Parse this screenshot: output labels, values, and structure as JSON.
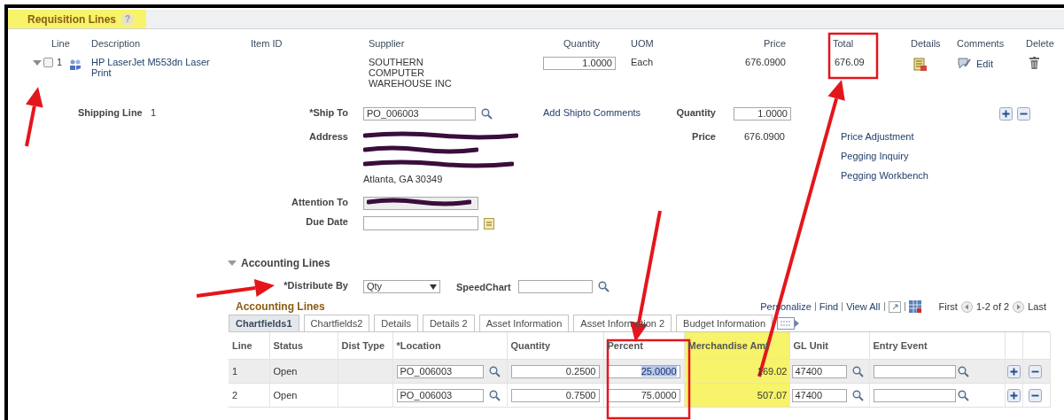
{
  "section": {
    "title": "Requisition Lines",
    "help": "?",
    "highlighted": true
  },
  "columns": [
    "Line",
    "Description",
    "Item ID",
    "Supplier",
    "Quantity",
    "UOM",
    "Price",
    "Total",
    "Details",
    "Comments",
    "Delete"
  ],
  "line": {
    "expanded": true,
    "checked": false,
    "number": "1",
    "description": "HP LaserJet M553dn Laser Print",
    "supplier": "SOUTHERN COMPUTER WAREHOUSE INC",
    "quantity": "1.0000",
    "uom": "Each",
    "price": "676.0900",
    "total": "676.09",
    "comments_link": "Edit"
  },
  "shipping": {
    "label": "Shipping Line",
    "number": "1",
    "ship_to_label": "*Ship To",
    "ship_to": "PO_006003",
    "address_label": "Address",
    "address_city": "Atlanta, GA  30349",
    "attention_label": "Attention To",
    "due_date_label": "Due Date",
    "comments_link": "Add Shipto Comments",
    "quantity_label": "Quantity",
    "quantity": "1.0000",
    "price_label": "Price",
    "price": "676.0900",
    "links": [
      "Price Adjustment",
      "Pegging Inquiry",
      "Pegging Workbench"
    ]
  },
  "accounting": {
    "title": "Accounting Lines",
    "expanded": true,
    "distribute_label": "*Distribute By",
    "distribute_by": "Qty",
    "speedchart_label": "SpeedChart"
  },
  "grid": {
    "title": "Accounting Lines",
    "nav": [
      "Personalize",
      "Find",
      "View All"
    ],
    "first": "First",
    "range": "1-2 of 2",
    "last": "Last",
    "tabs": [
      {
        "label": "Chartfields1",
        "selected": true
      },
      {
        "label": "Chartfields2",
        "selected": false
      },
      {
        "label": "Details",
        "selected": false
      },
      {
        "label": "Details 2",
        "selected": false
      },
      {
        "label": "Asset Information",
        "selected": false
      },
      {
        "label": "Asset Information 2",
        "selected": false
      },
      {
        "label": "Budget Information",
        "selected": false
      }
    ],
    "columns": [
      {
        "label": "Line",
        "highlighted": false
      },
      {
        "label": "Status",
        "highlighted": false
      },
      {
        "label": "Dist Type",
        "highlighted": false
      },
      {
        "label": "*Location",
        "highlighted": false
      },
      {
        "label": "Quantity",
        "highlighted": false
      },
      {
        "label": "Percent",
        "highlighted": false
      },
      {
        "label": "Merchandise Amt",
        "highlighted": true
      },
      {
        "label": "GL Unit",
        "highlighted": false
      },
      {
        "label": "Entry Event",
        "highlighted": false
      }
    ],
    "rows": [
      {
        "line": "1",
        "status": "Open",
        "location": "PO_006003",
        "quantity": "0.2500",
        "percent": "25.0000",
        "text_selected": true,
        "amount": "169.02",
        "gl_unit": "47400"
      },
      {
        "line": "2",
        "status": "Open",
        "location": "PO_006003",
        "quantity": "0.7500",
        "percent": "75.0000",
        "text_selected": false,
        "amount": "507.07",
        "gl_unit": "47400"
      }
    ]
  }
}
